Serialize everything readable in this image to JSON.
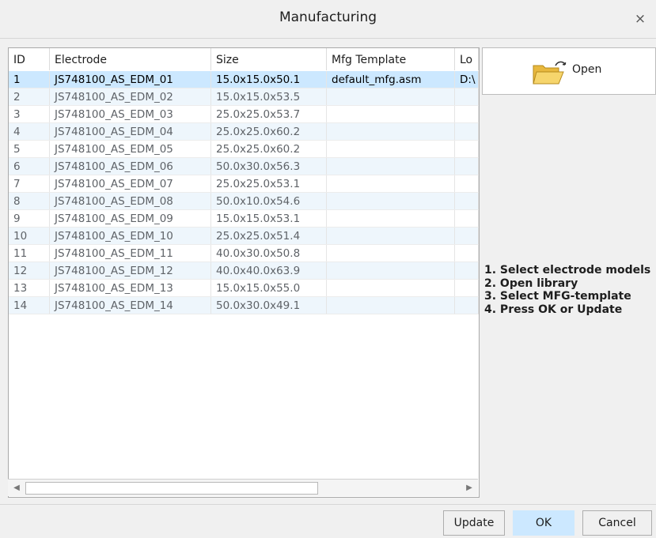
{
  "window": {
    "title": "Manufacturing",
    "close_glyph": "×"
  },
  "table": {
    "columns": [
      "ID",
      "Electrode",
      "Size",
      "Mfg Template",
      "Lo"
    ],
    "rows": [
      {
        "id": "1",
        "electrode": "JS748100_AS_EDM_01",
        "size": "15.0x15.0x50.1",
        "template": "default_mfg.asm",
        "location": "D:\\"
      },
      {
        "id": "2",
        "electrode": "JS748100_AS_EDM_02",
        "size": "15.0x15.0x53.5",
        "template": "",
        "location": ""
      },
      {
        "id": "3",
        "electrode": "JS748100_AS_EDM_03",
        "size": "25.0x25.0x53.7",
        "template": "",
        "location": ""
      },
      {
        "id": "4",
        "electrode": "JS748100_AS_EDM_04",
        "size": "25.0x25.0x60.2",
        "template": "",
        "location": ""
      },
      {
        "id": "5",
        "electrode": "JS748100_AS_EDM_05",
        "size": "25.0x25.0x60.2",
        "template": "",
        "location": ""
      },
      {
        "id": "6",
        "electrode": "JS748100_AS_EDM_06",
        "size": "50.0x30.0x56.3",
        "template": "",
        "location": ""
      },
      {
        "id": "7",
        "electrode": "JS748100_AS_EDM_07",
        "size": "25.0x25.0x53.1",
        "template": "",
        "location": ""
      },
      {
        "id": "8",
        "electrode": "JS748100_AS_EDM_08",
        "size": "50.0x10.0x54.6",
        "template": "",
        "location": ""
      },
      {
        "id": "9",
        "electrode": "JS748100_AS_EDM_09",
        "size": "15.0x15.0x53.1",
        "template": "",
        "location": ""
      },
      {
        "id": "10",
        "electrode": "JS748100_AS_EDM_10",
        "size": "25.0x25.0x51.4",
        "template": "",
        "location": ""
      },
      {
        "id": "11",
        "electrode": "JS748100_AS_EDM_11",
        "size": "40.0x30.0x50.8",
        "template": "",
        "location": ""
      },
      {
        "id": "12",
        "electrode": "JS748100_AS_EDM_12",
        "size": "40.0x40.0x63.9",
        "template": "",
        "location": ""
      },
      {
        "id": "13",
        "electrode": "JS748100_AS_EDM_13",
        "size": "15.0x15.0x55.0",
        "template": "",
        "location": ""
      },
      {
        "id": "14",
        "electrode": "JS748100_AS_EDM_14",
        "size": "50.0x30.0x49.1",
        "template": "",
        "location": ""
      }
    ],
    "selected_row": 0
  },
  "scrollbar": {
    "left_arrow": "◀",
    "right_arrow": "▶"
  },
  "open_button": {
    "label": "Open",
    "icon": "open-folder-icon"
  },
  "instructions": [
    "1. Select electrode models",
    "2. Open library",
    "3. Select MFG-template",
    "4. Press OK or Update"
  ],
  "footer": {
    "update_label": "Update",
    "ok_label": "OK",
    "cancel_label": "Cancel"
  },
  "colors": {
    "selection": "#cce8ff",
    "row_alt": "#eef6fc",
    "folder": "#f4d35e"
  }
}
